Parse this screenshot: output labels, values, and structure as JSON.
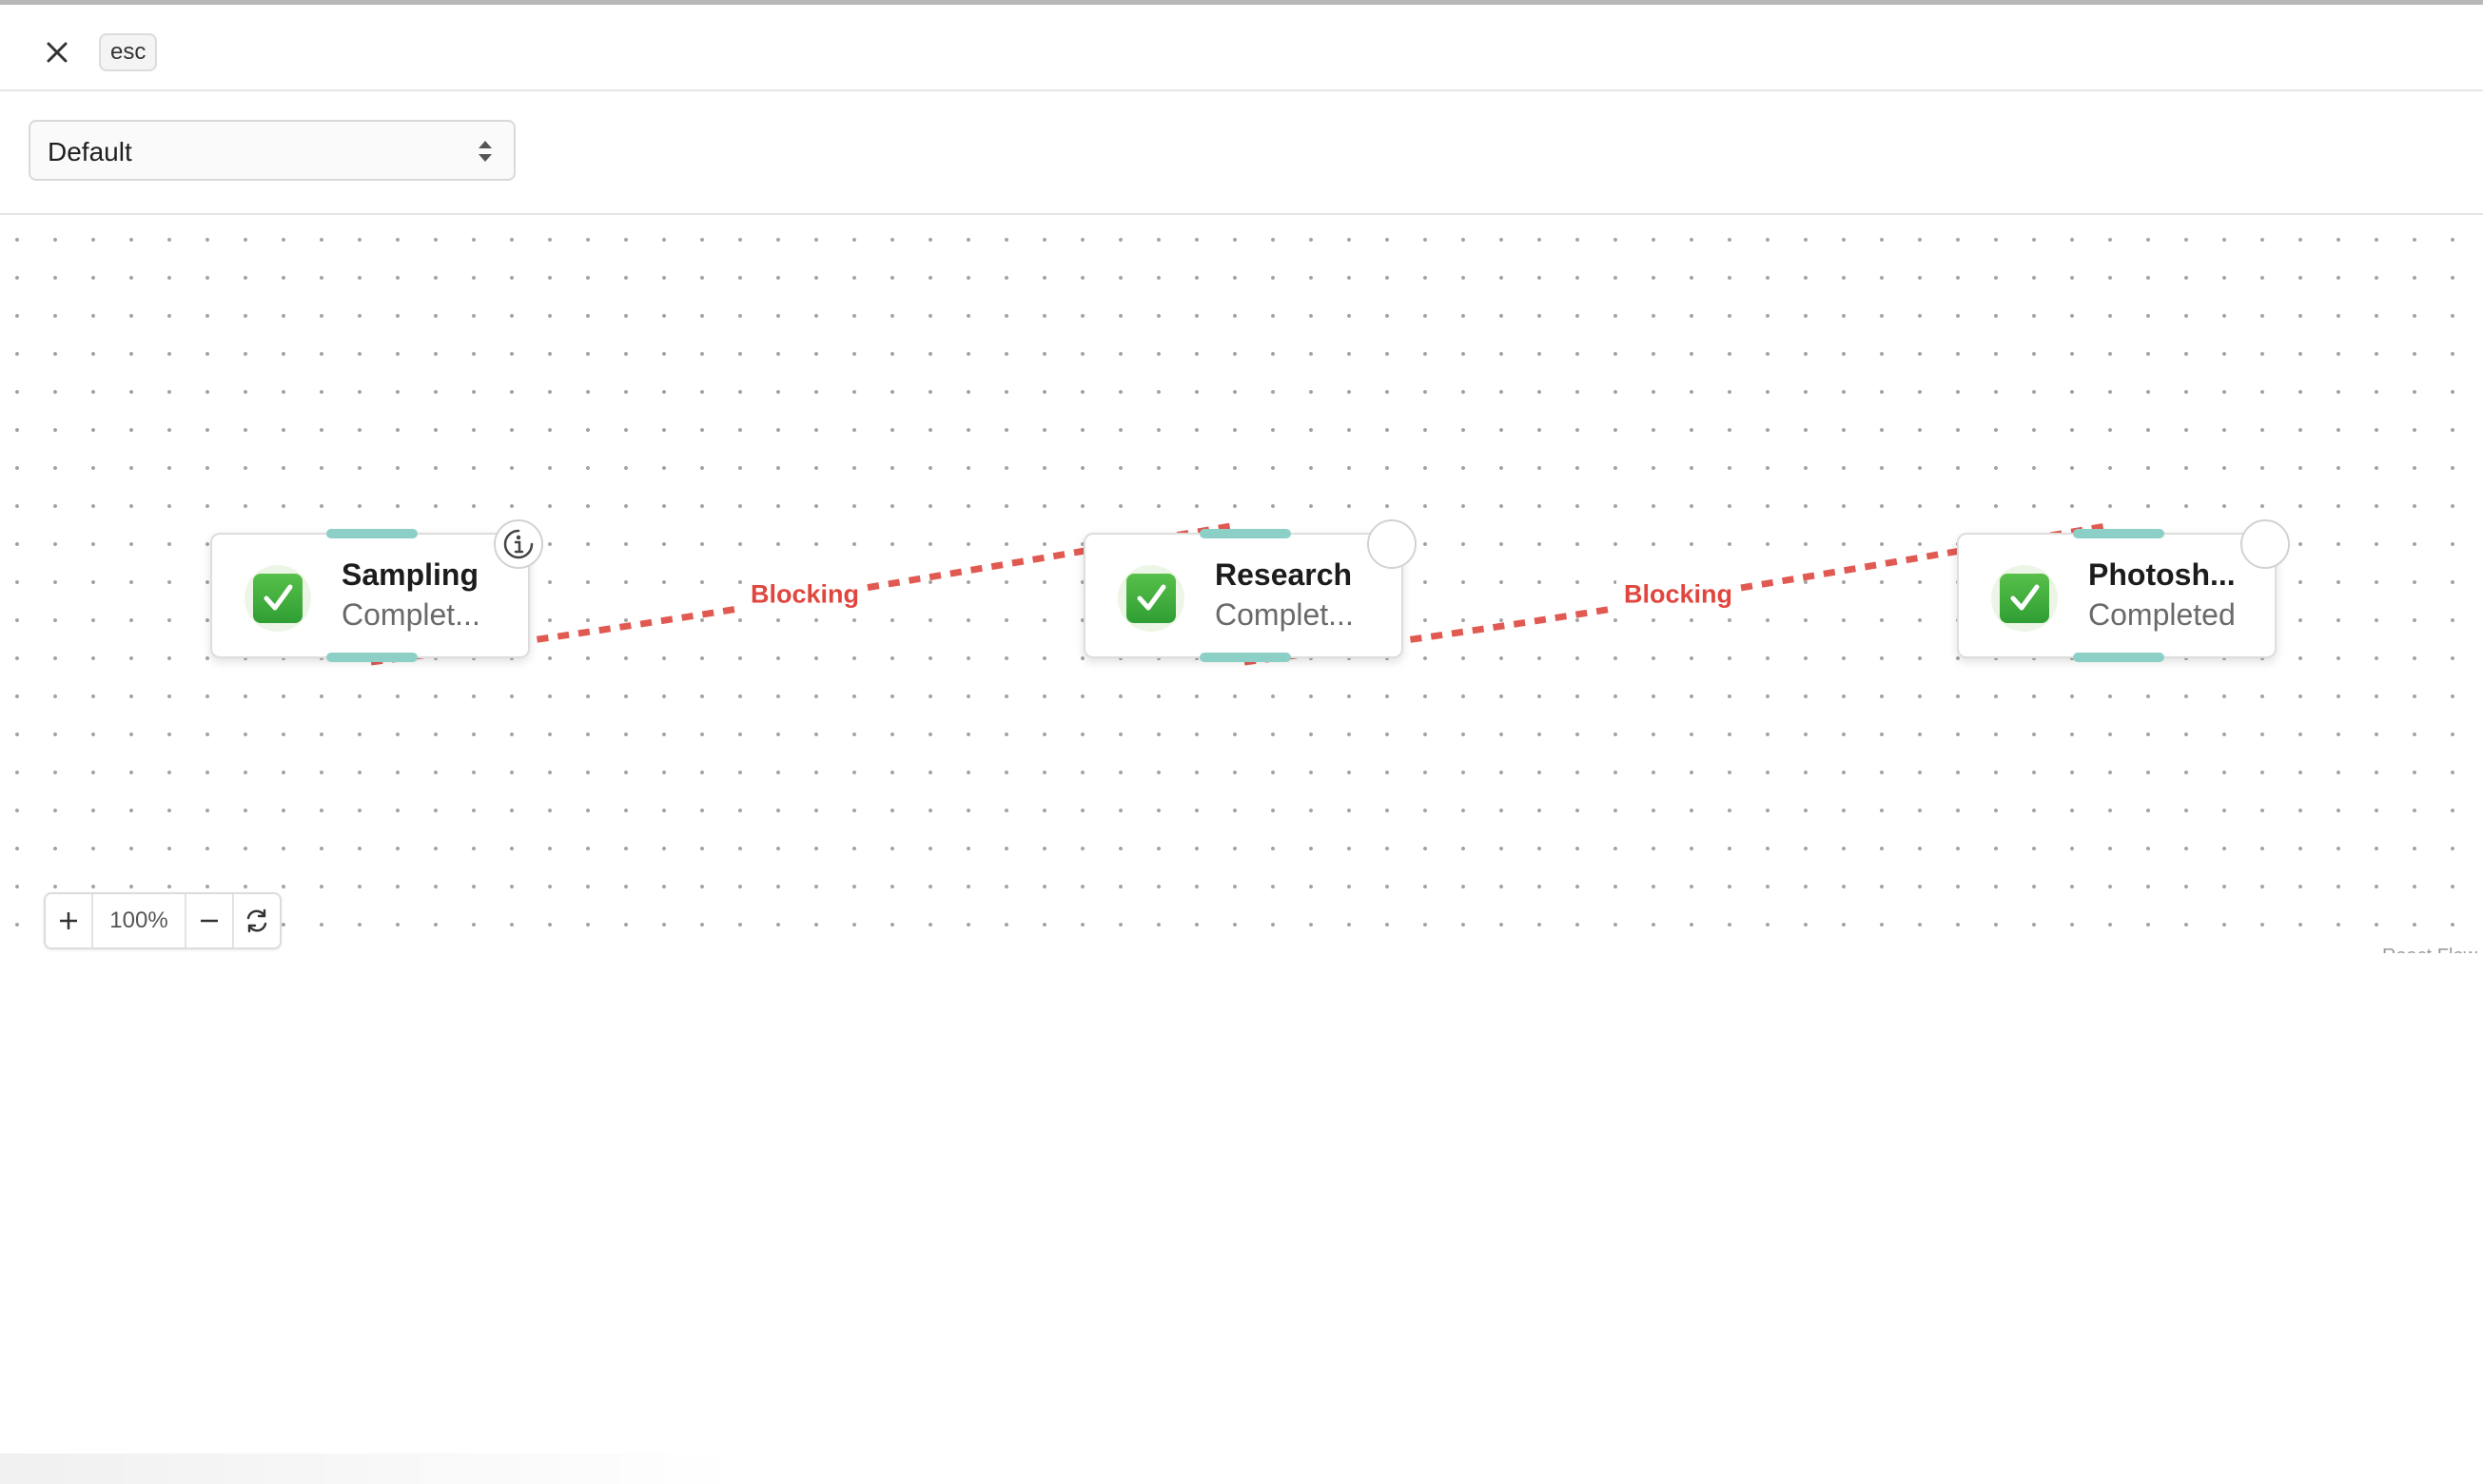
{
  "header": {
    "close_icon": "close-icon",
    "esc_label": "esc"
  },
  "selector": {
    "value": "Default",
    "caret_icon": "sort-caret-icon"
  },
  "flow": {
    "nodes": [
      {
        "title": "Sampling",
        "status": "Complet...",
        "status_icon": "check-mark-button-icon",
        "corner_icon": "info-icon"
      },
      {
        "title": "Research",
        "status": "Complet...",
        "status_icon": "check-mark-button-icon",
        "corner_icon": ""
      },
      {
        "title": "Photosh...",
        "status": "Completed",
        "status_icon": "check-mark-button-icon",
        "corner_icon": ""
      }
    ],
    "edges": [
      {
        "from": "Sampling",
        "to": "Research",
        "label": "Blocking"
      },
      {
        "from": "Research",
        "to": "Photosh...",
        "label": "Blocking"
      }
    ],
    "edge_color": "#e05a52",
    "handle_color": "#8ccfc7"
  },
  "controls": {
    "zoom_in_icon": "plus-icon",
    "zoom_level": "100%",
    "zoom_out_icon": "minus-icon",
    "reset_icon": "refresh-icon"
  },
  "attribution": "React Flow"
}
